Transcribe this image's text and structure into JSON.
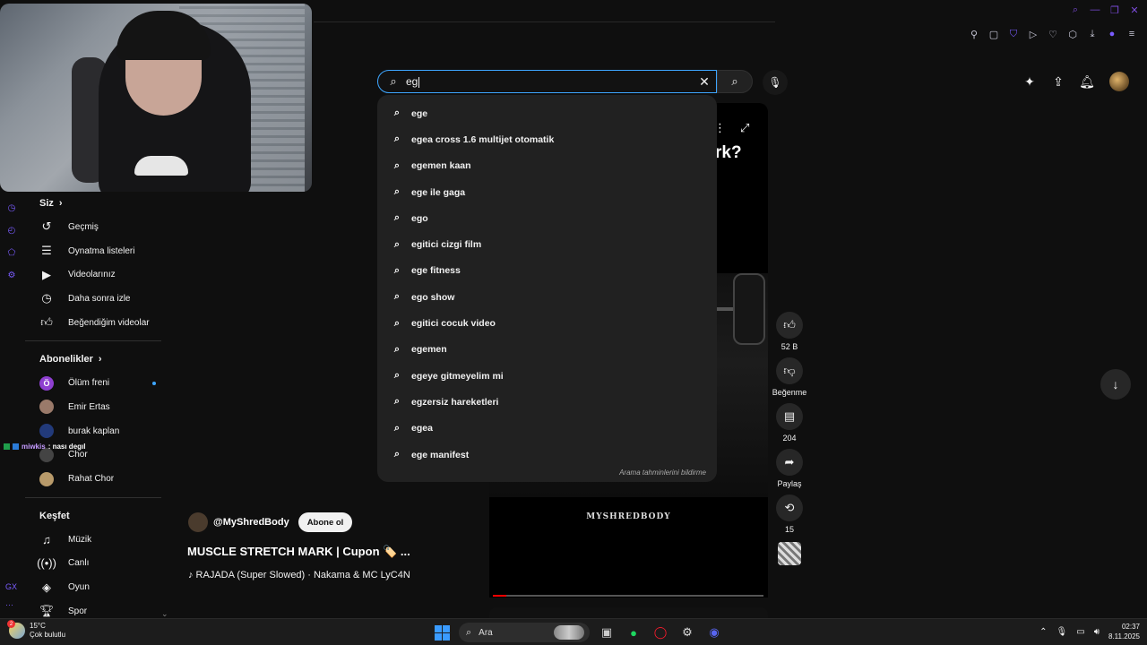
{
  "search": {
    "query": "eg",
    "suggestions": [
      "ege",
      "egea cross 1.6 multijet otomatik",
      "egemen kaan",
      "ege ile gaga",
      "ego",
      "egitici cizgi film",
      "ege fitness",
      "ego show",
      "egitici cocuk video",
      "egemen",
      "egeye gitmeyelim mi",
      "egzersiz hareketleri",
      "egea",
      "ege manifest"
    ],
    "footer": "Arama tahminlerini bildirme"
  },
  "sidebar": {
    "you_title": "Siz",
    "you_items": [
      {
        "label": "Geçmiş",
        "icon": "history-icon"
      },
      {
        "label": "Oynatma listeleri",
        "icon": "playlist-icon"
      },
      {
        "label": "Videolarınız",
        "icon": "video-icon"
      },
      {
        "label": "Daha sonra izle",
        "icon": "clock-icon"
      },
      {
        "label": "Beğendiğim videolar",
        "icon": "thumbs-up-icon"
      }
    ],
    "subs_title": "Abonelikler",
    "subs": [
      {
        "label": "Ölüm freni",
        "initial": "Ö",
        "color": "#8e3fd0",
        "live": true
      },
      {
        "label": "Emir Ertas",
        "initial": "",
        "color": "#9a7a6a",
        "live": false
      },
      {
        "label": "burak kaplan",
        "initial": "",
        "color": "#223a7a",
        "live": false
      },
      {
        "label": "Chor",
        "initial": "",
        "color": "#444444",
        "live": false
      },
      {
        "label": "Rahat Chor",
        "initial": "",
        "color": "#b89a6a",
        "live": false
      }
    ],
    "explore_title": "Keşfet",
    "explore": [
      {
        "label": "Müzik",
        "icon": "music-icon"
      },
      {
        "label": "Canlı",
        "icon": "live-icon"
      },
      {
        "label": "Oyun",
        "icon": "gaming-icon"
      },
      {
        "label": "Spor",
        "icon": "trophy-icon"
      }
    ]
  },
  "chat": {
    "user": "miwkis",
    "message": ": nası degıl"
  },
  "video": {
    "title_fragment": "rk?",
    "watermark": "MYSHREDBODY",
    "channel": "@MyShredBody",
    "subscribe_label": "Abone ol",
    "title": "MUSCLE STRETCH MARK | Cupon 🏷️ ...",
    "music": "♪ RAJADA (Super Slowed) · Nakama & MC LyC4N",
    "progress": 0.05
  },
  "actions": {
    "like_count": "52 B",
    "dislike_label": "Beğenme",
    "comment_count": "204",
    "share_label": "Paylaş",
    "remix_count": "15"
  },
  "taskbar": {
    "temp": "15°C",
    "weather": "Çok bulutlu",
    "weather_badge": "2",
    "search_label": "Ara",
    "time": "02:37",
    "date": "8.11.2025"
  },
  "colors": {
    "accent": "#3ea6ff",
    "background": "#0f0f0f",
    "dropdown": "#212121",
    "brand_purple": "#7b4bd8"
  }
}
